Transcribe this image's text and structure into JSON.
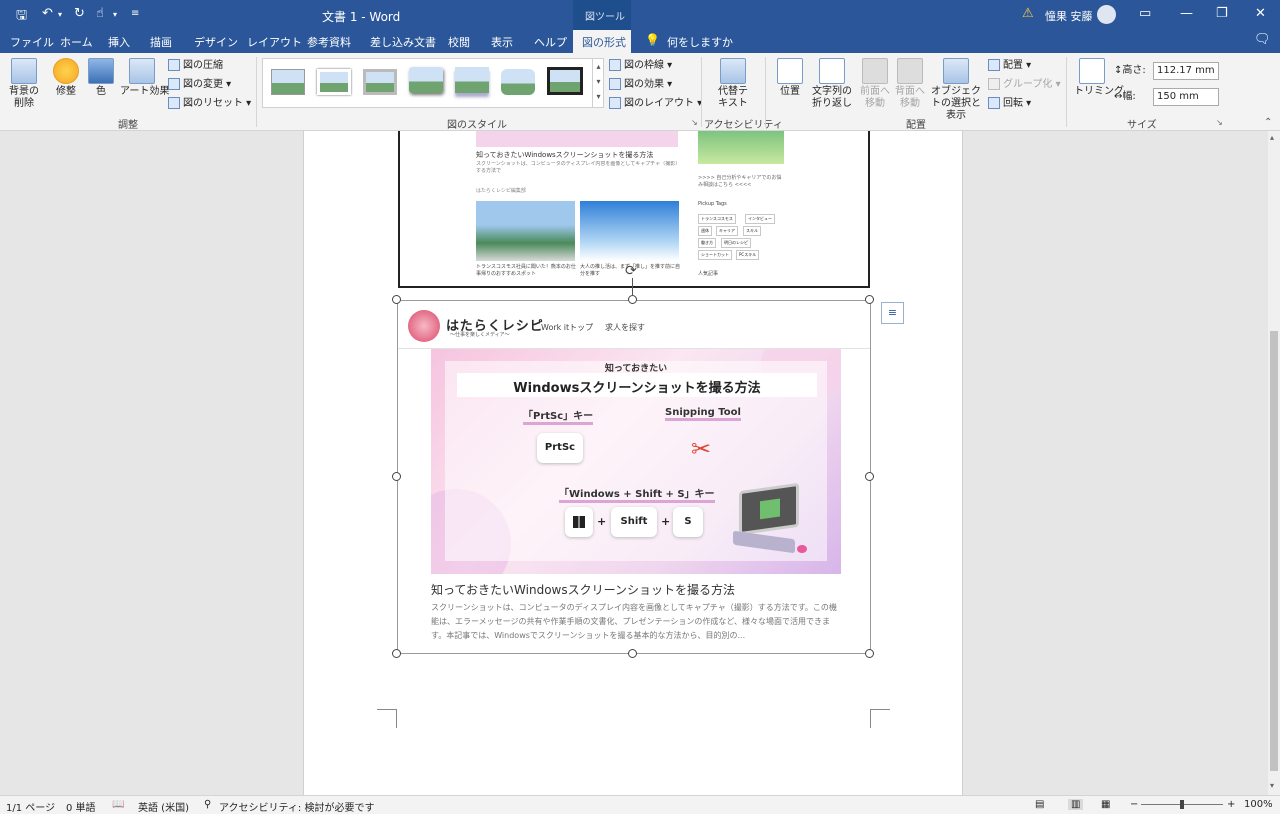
{
  "titlebar": {
    "doc_title": "文書 1 - Word",
    "context_tool": "図ツール",
    "user_name": "憧果 安藤"
  },
  "tabs": [
    "ファイル",
    "ホーム",
    "挿入",
    "描画",
    "デザイン",
    "レイアウト",
    "参考資料",
    "差し込み文書",
    "校閲",
    "表示",
    "ヘルプ",
    "図の形式"
  ],
  "tellme": "何をしますか",
  "ribbon": {
    "adjust": {
      "remove_bg": "背景の削除",
      "corrections": "修整",
      "color": "色",
      "art_effects": "アート効果",
      "compress": "図の圧縮",
      "change": "図の変更",
      "reset": "図のリセット",
      "label": "調整"
    },
    "styles": {
      "border": "図の枠線",
      "effects": "図の効果",
      "layout": "図のレイアウト",
      "label": "図のスタイル"
    },
    "accessibility": {
      "alt_text": "代替テキスト",
      "label": "アクセシビリティ"
    },
    "arrange": {
      "position": "位置",
      "wrap": "文字列の折り返し",
      "forward": "前面へ移動",
      "backward": "背面へ移動",
      "selection": "オブジェクトの選択と表示",
      "align": "配置",
      "group": "グループ化",
      "rotate": "回転",
      "label": "配置"
    },
    "size": {
      "crop": "トリミング",
      "height_label": "高さ:",
      "height_value": "112.17 mm",
      "width_label": "幅:",
      "width_value": "150 mm",
      "label": "サイズ"
    }
  },
  "top_image": {
    "article_title": "知っておきたいWindowsスクリーンショットを撮る方法",
    "article_snippet": "スクリーンショットは、コンピュータのディスプレイ内容を画像としてキャプチャ（撮影）する方法で",
    "author": "はたらくレシピ編集部",
    "pickup": "Pickup Tags",
    "tags": [
      "トランスコスモス",
      "インタビュー",
      "週休",
      "キャリア",
      "スキル",
      "働き方",
      "明日のレシピ",
      "ショートカット",
      "PCスキル"
    ],
    "caption_left": "トランスコスモス社員に聞いた！熊本のお仕事帰りのおすすめスポット",
    "caption_right": "大人の推し活は、まず「推し」を推す前に自分を推す",
    "sidebar_text": ">>>> 自己分析やキャリアでのお悩み相談はこちら <<<<",
    "popular": "人気記事"
  },
  "selected_image": {
    "logo_text": "はたらくレシピ",
    "logo_sub": "〜仕事を楽しくメディア〜",
    "nav1": "Work itトップ",
    "nav2": "求人を探す",
    "banner_small": "知っておきたい",
    "banner_title": "Windowsスクリーンショットを撮る方法",
    "prtsc_label": "「PrtSc」キー",
    "snip_label": "Snipping Tool",
    "prtsc_key": "PrtSc",
    "combo_label": "「Windows + Shift + S」キー",
    "plus": "+",
    "shift_key": "Shift",
    "s_key": "S",
    "article_title": "知っておきたいWindowsスクリーンショットを撮る方法",
    "article_body": "スクリーンショットは、コンピュータのディスプレイ内容を画像としてキャプチャ（撮影）する方法です。この機能は、エラーメッセージの共有や作業手順の文書化、プレゼンテーションの作成など、様々な場面で活用できます。本記事では、Windowsでスクリーンショットを撮る基本的な方法から、目的別の..."
  },
  "status": {
    "page": "1/1 ページ",
    "words": "0 単語",
    "lang": "英語 (米国)",
    "accessibility": "アクセシビリティ: 検討が必要です",
    "zoom": "100%"
  },
  "colors": {
    "word_blue": "#2b579a",
    "ribbon_bg": "#f3f3f3",
    "banner_pink": "#f4c7e3",
    "selected_tab_bg": "#f3f3f3"
  }
}
